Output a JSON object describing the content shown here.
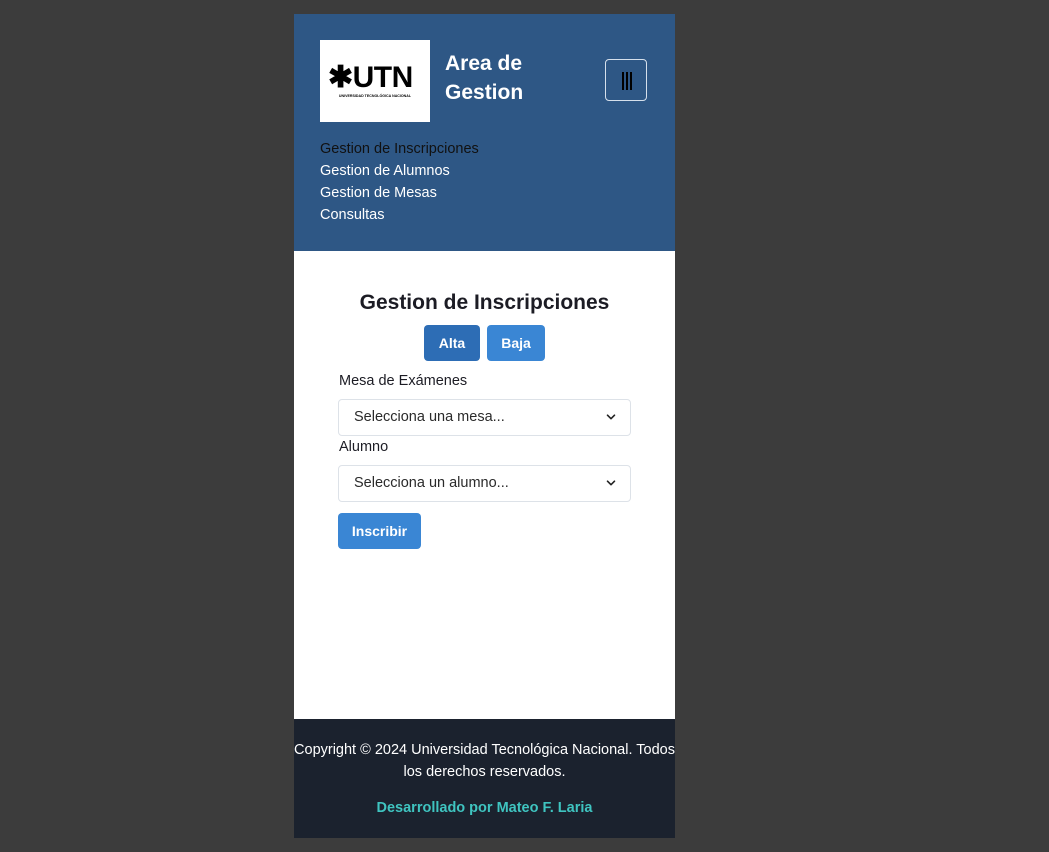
{
  "header": {
    "logo": {
      "mark": "✱UTN",
      "subtitle": "UNIVERSIDAD TECNOLÓGICA NACIONAL"
    },
    "brand_title": "Area de Gestion",
    "menu_icon": "menu-icon"
  },
  "nav": {
    "items": [
      {
        "label": "Gestion de Inscripciones",
        "active": true
      },
      {
        "label": "Gestion de Alumnos",
        "active": false
      },
      {
        "label": "Gestion de Mesas",
        "active": false
      },
      {
        "label": "Consultas",
        "active": false
      }
    ]
  },
  "main": {
    "title": "Gestion de Inscripciones",
    "buttons": {
      "alta": "Alta",
      "baja": "Baja",
      "inscribir": "Inscribir"
    },
    "fields": {
      "mesa": {
        "label": "Mesa de Exámenes",
        "value": "Selecciona una mesa..."
      },
      "alumno": {
        "label": "Alumno",
        "value": "Selecciona un alumno..."
      }
    }
  },
  "footer": {
    "copyright": "Copyright © 2024 Universidad Tecnológica Nacional. Todos los derechos reservados.",
    "credit": "Desarrollado por Mateo F. Laria"
  },
  "colors": {
    "header_bg": "#2e5785",
    "footer_bg": "#1b222e",
    "primary": "#3a86d4",
    "primary_active": "#2d6db5",
    "credit": "#3fc4c0"
  }
}
